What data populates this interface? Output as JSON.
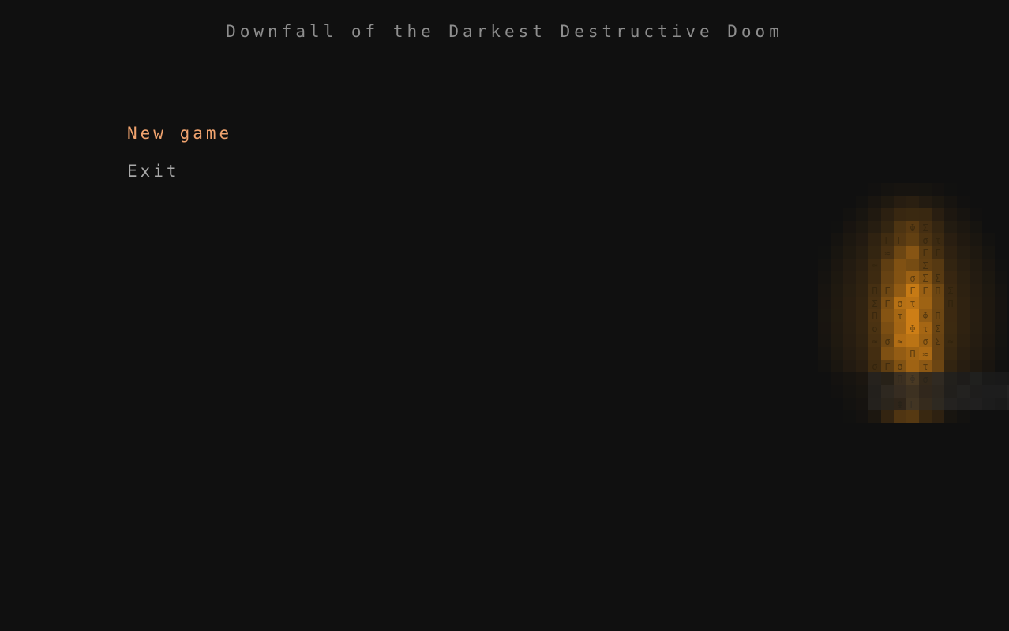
{
  "game": {
    "title": "Downfall of the Darkest Destructive Doom"
  },
  "menu": {
    "items": [
      {
        "label": "New game",
        "selected": true
      },
      {
        "label": "Exit",
        "selected": false
      }
    ]
  },
  "colors": {
    "background": "#101010",
    "title": "#8e8e8e",
    "menu_selected": "#f0a36e",
    "menu_normal": "#a9a9a9",
    "fire_dark": "#2a2110",
    "fire_mid": "#7a4f12",
    "fire_bright": "#c98a1c",
    "smoke": "#3a3a3a"
  },
  "fire": {
    "glyphs": [
      "σ",
      "Φ",
      "Π",
      "Γ",
      "≈",
      "Σ",
      "τ"
    ],
    "icon": "ascii-fire-icon"
  }
}
